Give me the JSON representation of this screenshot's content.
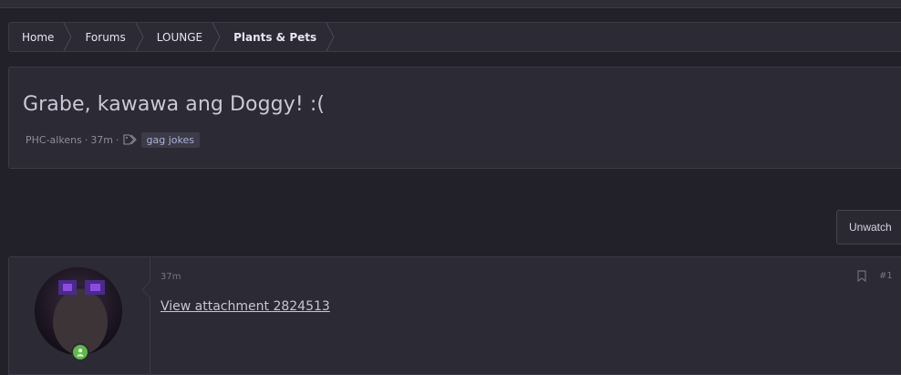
{
  "breadcrumb": {
    "items": [
      {
        "label": "Home"
      },
      {
        "label": "Forums"
      },
      {
        "label": "LOUNGE"
      },
      {
        "label": "Plants & Pets"
      }
    ]
  },
  "thread": {
    "title": "Grabe, kawawa ang Doggy! :(",
    "author": "PHC-alkens",
    "time": "37m",
    "tag": "gag jokes"
  },
  "actions": {
    "unwatch_label": "Unwatch"
  },
  "post": {
    "time": "37m",
    "attachment_text": "View attachment 2824513",
    "post_number": "#1"
  },
  "colors": {
    "background": "#222129",
    "panel": "#2b2a35",
    "border": "#3b3a46",
    "tag_bg": "#3c3b47",
    "online": "#5fb848"
  },
  "icons": [
    "chevron-separator-icon",
    "tag-icon",
    "bookmark-icon",
    "online-status-icon"
  ]
}
